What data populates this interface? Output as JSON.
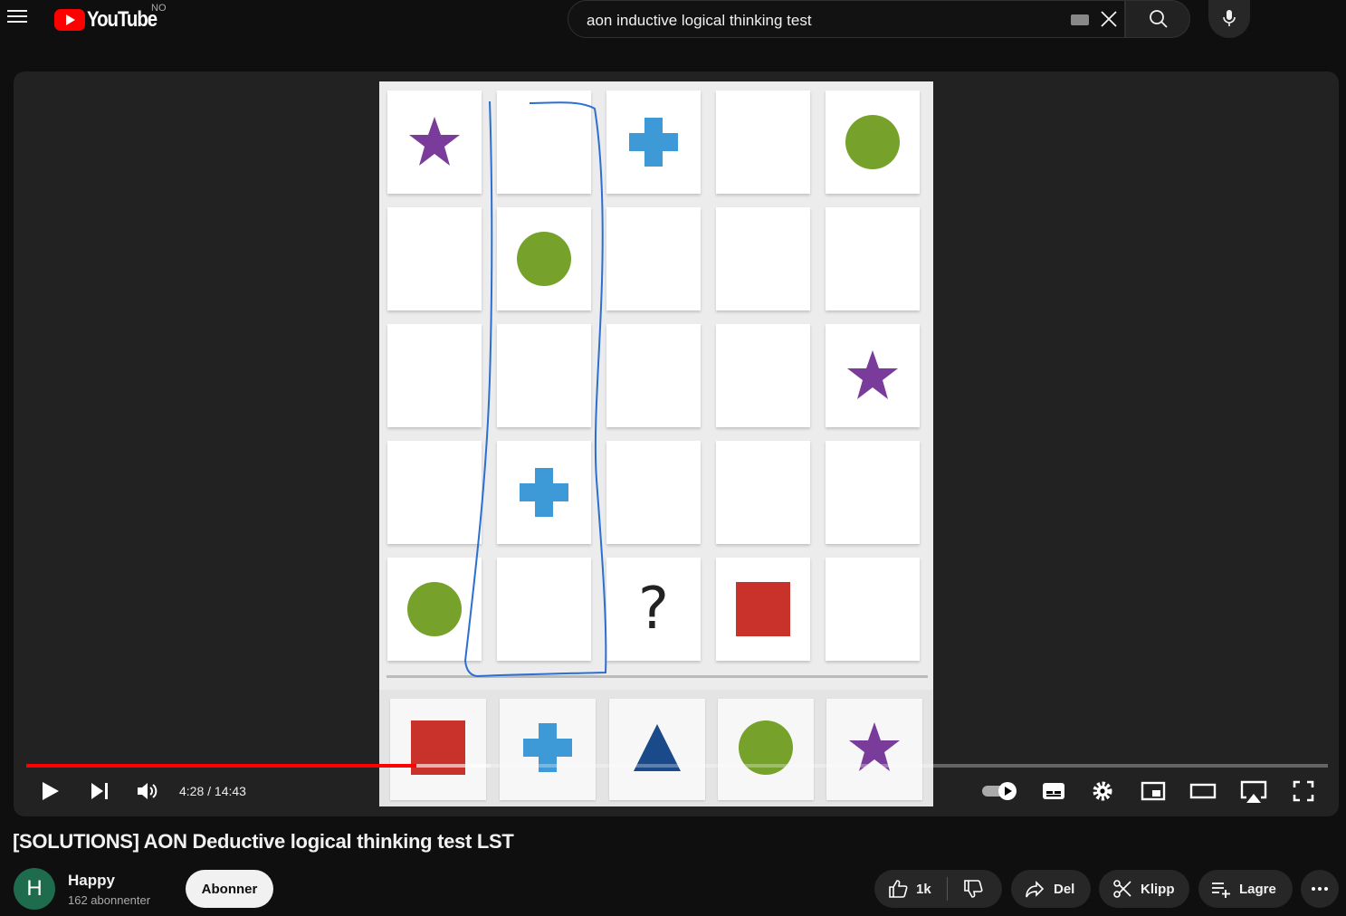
{
  "header": {
    "logo_text": "YouTube",
    "country_code": "NO",
    "search": {
      "value": "aon inductive logical thinking test"
    }
  },
  "player": {
    "time_display": "4:28 / 14:43",
    "progress_fraction": 0.3,
    "puzzle_question_mark": "?",
    "grid_rows": [
      [
        "star",
        "",
        "cross",
        "",
        "circle"
      ],
      [
        "",
        "circle",
        "",
        "",
        ""
      ],
      [
        "",
        "",
        "",
        "",
        "star"
      ],
      [
        "",
        "cross",
        "",
        "",
        ""
      ],
      [
        "circle",
        "",
        "?",
        "square",
        ""
      ]
    ],
    "answer_options": [
      "square",
      "cross",
      "triangle",
      "circle",
      "star"
    ],
    "colors": {
      "star": "#7a3c9a",
      "cross": "#3d9ad6",
      "circle": "#76a22b",
      "square": "#c9322a",
      "triangle": "#1a4a8a",
      "progress": "#ff0000"
    }
  },
  "video": {
    "title": "[SOLUTIONS] AON Deductive logical thinking test LST",
    "channel": {
      "initial": "H",
      "name": "Happy",
      "subscribers": "162 abonnenter"
    },
    "subscribe_label": "Abonner",
    "like_count": "1k",
    "share_label": "Del",
    "clip_label": "Klipp",
    "save_label": "Lagre"
  }
}
